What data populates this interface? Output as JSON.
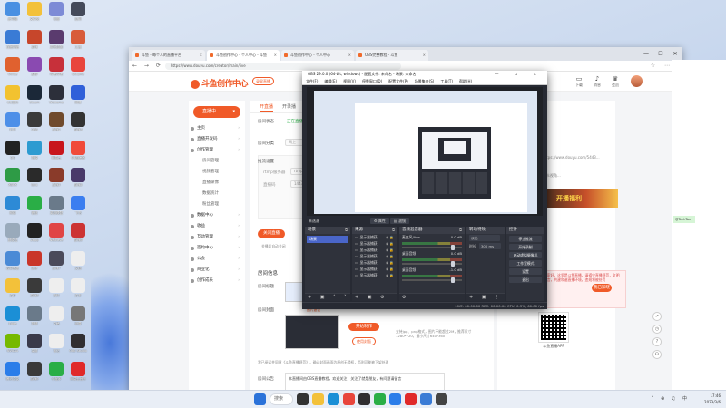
{
  "desktop": {
    "icons": [
      {
        "label": "此电脑",
        "color": "#4a90e2"
      },
      {
        "label": "文件夹",
        "color": "#f3c13a"
      },
      {
        "label": "动漫",
        "color": "#7d8bd6"
      },
      {
        "label": "应用",
        "color": "#444a5a"
      },
      {
        "label": "百度网盘",
        "color": "#3a7bd5"
      },
      {
        "label": "游戏",
        "color": "#c7462b"
      },
      {
        "label": "游戏加加",
        "color": "#5a3b6e"
      },
      {
        "label": "工具",
        "color": "#d85b3a"
      },
      {
        "label": "Office",
        "color": "#e0612f"
      },
      {
        "label": "原神",
        "color": "#8a4ab1"
      },
      {
        "label": "哔哩哔哩",
        "color": "#c7303a"
      },
      {
        "label": "Chrome",
        "color": "#e8453c"
      },
      {
        "label": "QQ音乐",
        "color": "#f2c230"
      },
      {
        "label": "Steam",
        "color": "#1b2838"
      },
      {
        "label": "WeGame",
        "color": "#2c2f3a"
      },
      {
        "label": "网易",
        "color": "#3060d9"
      },
      {
        "label": "钉钉",
        "color": "#4d8fe8"
      },
      {
        "label": "OBS",
        "color": "#3b3b3b"
      },
      {
        "label": "游戏2",
        "color": "#6f4a2d"
      },
      {
        "label": "游戏3",
        "color": "#333"
      },
      {
        "label": "QQ",
        "color": "#222"
      },
      {
        "label": "剪映",
        "color": "#2d9bd1"
      },
      {
        "label": "网易云",
        "color": "#c8161d"
      },
      {
        "label": "UU加速器",
        "color": "#f04a3a"
      },
      {
        "label": "XBOX",
        "color": "#2e9b46"
      },
      {
        "label": "Epic",
        "color": "#2a2a2a"
      },
      {
        "label": "游戏4",
        "color": "#8a3b2a"
      },
      {
        "label": "游戏5",
        "color": "#4a3a6a"
      },
      {
        "label": "网络",
        "color": "#2d8ad6"
      },
      {
        "label": "微信",
        "color": "#2aae46"
      },
      {
        "label": "英雄联盟",
        "color": "#6a7a8a"
      },
      {
        "label": "飞书",
        "color": "#3b7ef0"
      },
      {
        "label": "回收站",
        "color": "#9ab"
      },
      {
        "label": "Zepp",
        "color": "#222"
      },
      {
        "label": "NetEase",
        "color": "#e04545"
      },
      {
        "label": "游戏6",
        "color": "#c33"
      },
      {
        "label": "控制面板",
        "color": "#4a8ad6"
      },
      {
        "label": "虎牙",
        "color": "#c9362a"
      },
      {
        "label": "游戏7",
        "color": "#4a4a5a"
      },
      {
        "label": "文档",
        "color": "#eee"
      },
      {
        "label": "文件",
        "color": "#f3c13a"
      },
      {
        "label": "游戏8",
        "color": "#3a3a3a"
      },
      {
        "label": "资料",
        "color": "#eee"
      },
      {
        "label": "文本",
        "color": "#eee"
      },
      {
        "label": "Edge",
        "color": "#1b8fd6"
      },
      {
        "label": "剪辑",
        "color": "#6a7a8a"
      },
      {
        "label": "文稿",
        "color": "#eee"
      },
      {
        "label": "设置",
        "color": "#777"
      },
      {
        "label": "NVIDIA",
        "color": "#76b900"
      },
      {
        "label": "录屏",
        "color": "#3a3a4a"
      },
      {
        "label": "笔记",
        "color": "#eee"
      },
      {
        "label": "OBS Studio",
        "color": "#302e31"
      },
      {
        "label": "腾讯会议",
        "color": "#2b7de9"
      },
      {
        "label": "游戏9",
        "color": "#3a3a3a"
      },
      {
        "label": "小程序",
        "color": "#2aae46"
      },
      {
        "label": "网易云音乐",
        "color": "#e02a2a"
      }
    ]
  },
  "browser": {
    "tabs": [
      {
        "label": "斗鱼 - 每个人的直播平台",
        "active": false
      },
      {
        "label": "斗鱼创作中心 - 个人中心 - 斗鱼",
        "active": true
      },
      {
        "label": "斗鱼创作中心 - 个人中心",
        "active": false
      },
      {
        "label": "OBS完整教程 - 斗鱼",
        "active": false
      }
    ],
    "url": "https://www.douyu.com/creator/main/live",
    "window_controls": {
      "minimize": "—",
      "maximize": "☐",
      "close": "✕"
    }
  },
  "site": {
    "logo": "斗鱼创作中心",
    "record_label": "录屏直播",
    "header_icons": [
      {
        "icon": "tv-icon",
        "label": "下载"
      },
      {
        "icon": "bell-icon",
        "label": "消息"
      },
      {
        "icon": "crown-icon",
        "label": "会员"
      }
    ],
    "live_button": "直播中",
    "nav": [
      {
        "label": "主页",
        "sub": false
      },
      {
        "label": "直播开发码",
        "sub": false
      },
      {
        "label": "创作管理",
        "sub": false
      },
      {
        "label": "房间管理",
        "sub": true
      },
      {
        "label": "视频管理",
        "sub": true
      },
      {
        "label": "直播录像",
        "sub": true
      },
      {
        "label": "数据统计",
        "sub": true
      },
      {
        "label": "粉丝管理",
        "sub": true
      },
      {
        "label": "数据中心",
        "sub": false
      },
      {
        "label": "收益",
        "sub": false
      },
      {
        "label": "互动管理",
        "sub": false
      },
      {
        "label": "签约中心",
        "sub": false
      },
      {
        "label": "公会",
        "sub": false
      },
      {
        "label": "商业化",
        "sub": false
      },
      {
        "label": "创作成长",
        "sub": false
      }
    ],
    "content": {
      "tabs": [
        "开直播",
        "开录播"
      ],
      "room_status_label": "房间状态",
      "room_status_value": "正在直播",
      "room_category_label": "房间分类",
      "room_category_value": "网上",
      "push_settings": "推流设置",
      "server_label": "rtmp服务器",
      "server_value": "rtmp://sendtc3.douyu.com/live",
      "key_label": "直播码",
      "key_value": "1443392rBdkh4...",
      "close_live": "关闭直播",
      "auto_close_note": "关播后自动关闭",
      "room_info": "房间信息",
      "room_title_label": "房间标题",
      "cover_label": "房间封面",
      "cover_hint": "图片建议",
      "upload_button": "开始制作",
      "use_last_button": "使用封面",
      "cover_tip": "支持jpg、png格式，图片不能超过2M，推荐尺寸1280*720，最小尺寸640*360",
      "agree_text": "我已阅读并同意《斗鱼直播规范》，确认封面画面为原创无侵权，否则可能被下架处理",
      "announce_label": "房间公告",
      "announce_text": "本直播间由OBS直播教程，欢迎关注，关注了就是朋友，有问题请留言"
    },
    "right": {
      "url_text": "https://www.douyu.com/5443...",
      "small_note": "观众视角...",
      "banner_text": "开播福利",
      "notice": "大家好，这里是斗鱼直播，请遵守直播规范，文明发言，共建和谐直播环境，违规将被处罚",
      "notice_button": "我已知晓",
      "qr_caption": "斗鱼直播APP"
    },
    "green_chip": "@TechTon"
  },
  "obs": {
    "title": "OBS 29.0.0 (64-bit, windows) - 配置文件: 未命名 - 场景: 未命名",
    "window_controls": "— ☐ ✕",
    "menu": [
      "文件(F)",
      "编辑(E)",
      "视图(V)",
      "停靠窗口(D)",
      "配置文件(P)",
      "场景集合(S)",
      "工具(T)",
      "帮助(H)"
    ],
    "source_strip": {
      "label": "未选源",
      "props": "属性",
      "filters": "滤镜"
    },
    "docks": {
      "scenes": {
        "title": "场景",
        "items": [
          "场景"
        ]
      },
      "sources": {
        "title": "来源",
        "items": [
          "显示器捕获",
          "显示器捕获",
          "显示器捕获",
          "显示器捕获",
          "显示器捕获",
          "显示器捕获",
          "显示器捕获"
        ]
      },
      "mixer": {
        "title": "音频混音器",
        "rows": [
          {
            "name": "麦克风/Aux",
            "db": "0.0 dB"
          },
          {
            "name": "桌面音频",
            "db": "0.0 dB"
          },
          {
            "name": "桌面音频",
            "db": "-1.0 dB"
          }
        ]
      },
      "transitions": {
        "title": "转场特效",
        "type_label": "淡出",
        "duration_label": "时长",
        "duration_value": "300 ms"
      },
      "controls": {
        "title": "控件",
        "buttons": [
          "停止推流",
          "开始录制",
          "启动虚拟摄像机",
          "工作室模式",
          "设置",
          "退出"
        ]
      }
    },
    "status": "LIVE: 00:00:00   REC: 00:00:00   CPU: 0.3%, 60.00 fps"
  },
  "taskbar": {
    "search": "搜索",
    "time": "17:46",
    "date": "2023/3/6",
    "lang": "中",
    "apps": [
      {
        "icon": "windows-icon",
        "color": "#2a72d9"
      },
      {
        "icon": "search-icon",
        "color": "#fff"
      },
      {
        "icon": "taskview-icon",
        "color": "#333"
      },
      {
        "icon": "folder-icon",
        "color": "#f3c13a"
      },
      {
        "icon": "edge-icon",
        "color": "#1b8fd6"
      },
      {
        "icon": "chrome-icon",
        "color": "#e8453c"
      },
      {
        "icon": "obs-icon",
        "color": "#302e31"
      },
      {
        "icon": "wechat-icon",
        "color": "#2aae46"
      },
      {
        "icon": "qq-icon",
        "color": "#2b7de9"
      },
      {
        "icon": "music-icon",
        "color": "#e02a2a"
      },
      {
        "icon": "store-icon",
        "color": "#3a7bd5"
      },
      {
        "icon": "game-icon",
        "color": "#444"
      }
    ]
  }
}
